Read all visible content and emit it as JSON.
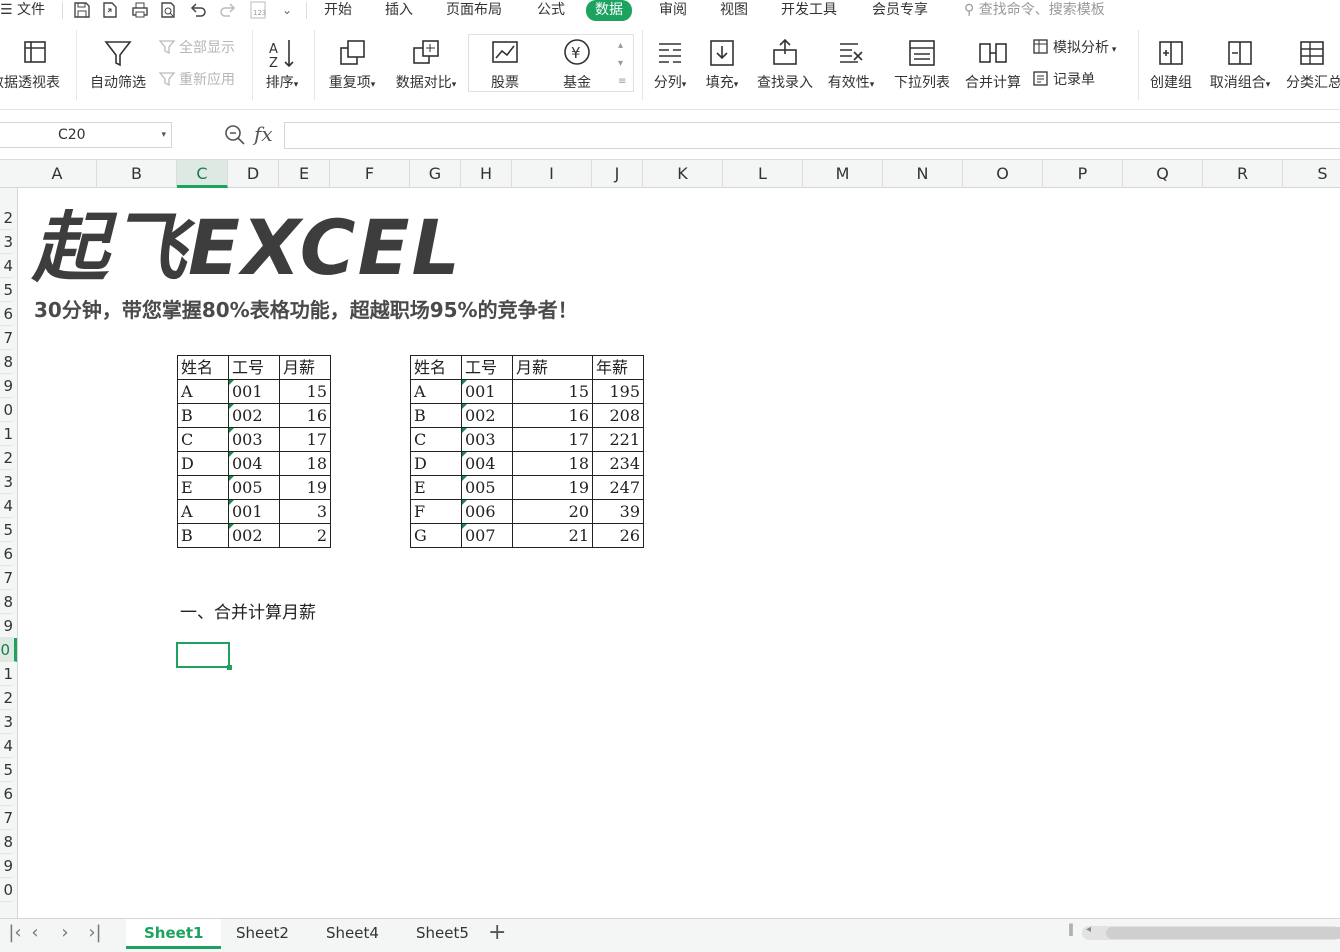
{
  "menu": {
    "file": "文件",
    "tabs": [
      "开始",
      "插入",
      "页面布局",
      "公式",
      "数据",
      "审阅",
      "视图",
      "开发工具",
      "会员专享"
    ],
    "active_tab": "数据",
    "search_placeholder": "查找命令、搜索模板"
  },
  "ribbon": {
    "pivot": "数据透视表",
    "autofilter": "自动筛选",
    "show_all": "全部显示",
    "reapply": "重新应用",
    "sort": "排序",
    "duplicates": "重复项",
    "compare": "数据对比",
    "stocks": "股票",
    "fund": "基金",
    "split": "分列",
    "fill": "填充",
    "lookup": "查找录入",
    "validity": "有效性",
    "dropdown": "下拉列表",
    "consolidate": "合并计算",
    "whatif": "模拟分析",
    "record": "记录单",
    "group": "创建组",
    "ungroup": "取消组合",
    "subtotal": "分类汇总"
  },
  "formula_bar": {
    "cell_ref": "C20",
    "fx": "fx",
    "value": ""
  },
  "columns": [
    "A",
    "B",
    "C",
    "D",
    "E",
    "F",
    "G",
    "H",
    "I",
    "J",
    "K",
    "L",
    "M",
    "N",
    "O",
    "P",
    "Q",
    "R",
    "S"
  ],
  "selected_column": "C",
  "rows": [
    "2",
    "3",
    "4",
    "5",
    "6",
    "7",
    "8",
    "9",
    "0",
    "1",
    "2",
    "3",
    "4",
    "5",
    "6",
    "7",
    "8",
    "9",
    "0",
    "1",
    "2",
    "3",
    "4",
    "5",
    "6",
    "7",
    "8",
    "9",
    "0"
  ],
  "selected_row": "0",
  "sheet": {
    "title": "起飞EXCEL",
    "subtitle": "30分钟，带您掌握80%表格功能，超越职场95%的竞争者！",
    "table1": {
      "headers": [
        "姓名",
        "工号",
        "月薪"
      ],
      "rows": [
        [
          "A",
          "001",
          "15"
        ],
        [
          "B",
          "002",
          "16"
        ],
        [
          "C",
          "003",
          "17"
        ],
        [
          "D",
          "004",
          "18"
        ],
        [
          "E",
          "005",
          "19"
        ],
        [
          "A",
          "001",
          "3"
        ],
        [
          "B",
          "002",
          "2"
        ]
      ]
    },
    "table2": {
      "headers": [
        "姓名",
        "工号",
        "月薪",
        "年薪"
      ],
      "rows": [
        [
          "A",
          "001",
          "15",
          "195"
        ],
        [
          "B",
          "002",
          "16",
          "208"
        ],
        [
          "C",
          "003",
          "17",
          "221"
        ],
        [
          "D",
          "004",
          "18",
          "234"
        ],
        [
          "E",
          "005",
          "19",
          "247"
        ],
        [
          "F",
          "006",
          "20",
          "39"
        ],
        [
          "G",
          "007",
          "21",
          "26"
        ]
      ]
    },
    "section_heading": "一、合并计算月薪"
  },
  "sheet_tabs": [
    "Sheet1",
    "Sheet2",
    "Sheet4",
    "Sheet5"
  ],
  "active_sheet": "Sheet1",
  "accent_color": "#1ba35f"
}
